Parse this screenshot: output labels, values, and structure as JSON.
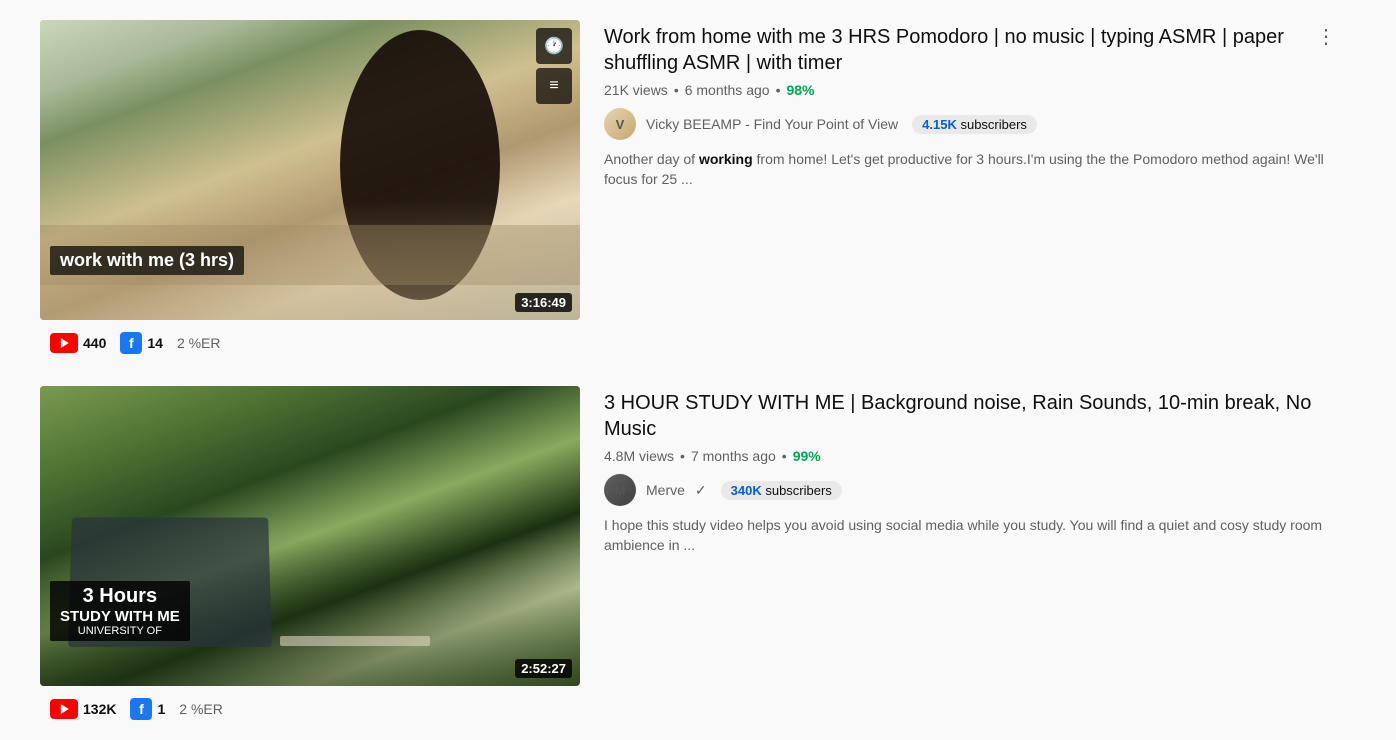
{
  "videos": [
    {
      "id": "video1",
      "title": "Work from home with me 3 HRS Pomodoro | no music | typing ASMR | paper shuffling ASMR | with timer",
      "views": "21K views",
      "posted": "6 months ago",
      "like_pct": "98%",
      "duration": "3:16:49",
      "channel_name": "Vicky BEEAMP - Find Your Point of View",
      "subscribers": "4.15K",
      "subscribers_label": "subscribers",
      "description": "Another day of working from home! Let's get productive for 3 hours.I'm using the the Pomodoro method again! We'll focus for 25 ...",
      "thumb_overlay": "work with me (3 hrs)",
      "yt_count": "440",
      "fb_count": "14",
      "er_pct": "2 %ER",
      "verified": false
    },
    {
      "id": "video2",
      "title": "3 HOUR STUDY WITH ME | Background noise, Rain Sounds, 10-min break, No Music",
      "views": "4.8M views",
      "posted": "7 months ago",
      "like_pct": "99%",
      "duration": "2:52:27",
      "channel_name": "Merve",
      "subscribers": "340K",
      "subscribers_label": "subscribers",
      "description": "I hope this study video helps you avoid using social media while you study. You will find a quiet and cosy study room ambience in ...",
      "thumb_overlay_big": "3 Hours",
      "thumb_overlay_main": "STUDY WITH ME",
      "thumb_overlay_small": "UNIVERSITY OF",
      "yt_count": "132K",
      "fb_count": "1",
      "er_pct": "2 %ER",
      "verified": true
    }
  ],
  "icons": {
    "clock": "🕐",
    "list": "≡",
    "three_dots": "⋮",
    "facebook_letter": "f",
    "verified_check": "✓"
  }
}
